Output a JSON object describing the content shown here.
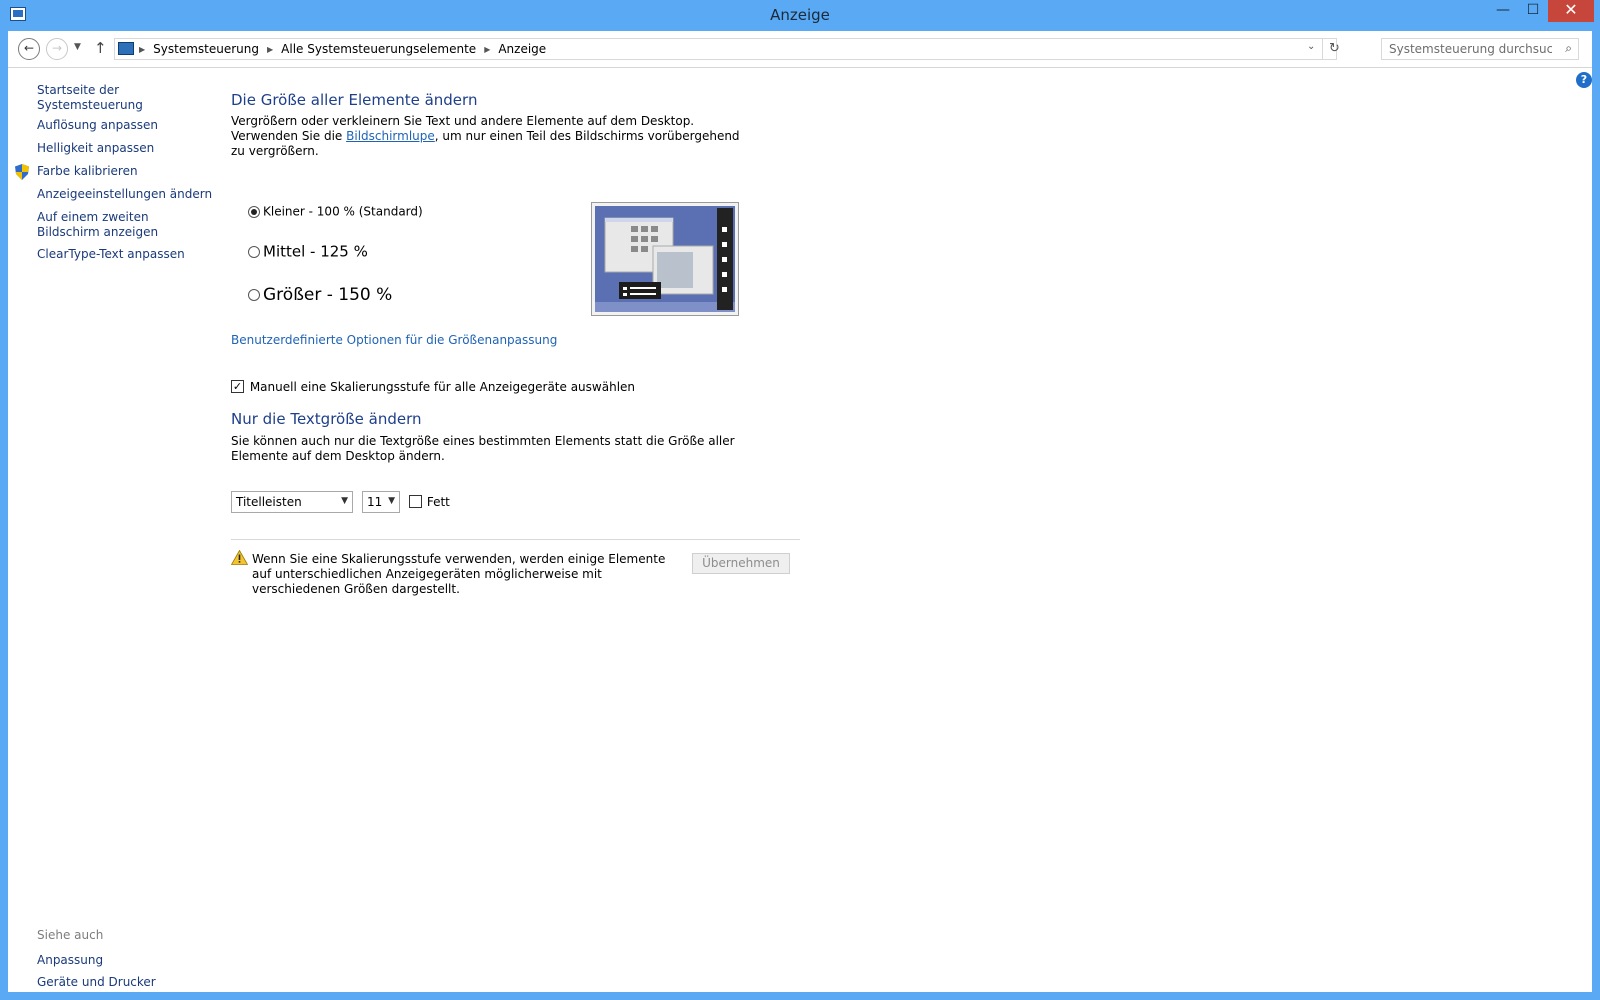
{
  "window": {
    "title": "Anzeige",
    "minimize": "—",
    "maximize": "☐",
    "close": "✕"
  },
  "nav": {
    "back": "←",
    "forward": "→",
    "recent": "▼",
    "up": "↑",
    "breadcrumbs": [
      "Systemsteuerung",
      "Alle Systemsteuerungselemente",
      "Anzeige"
    ],
    "breadcrumb_separator": "▶",
    "dropdown": "⌄",
    "refresh": "↻",
    "search_placeholder": "Systemsteuerung durchsuchen",
    "search_icon": "⌕"
  },
  "help": "?",
  "sidebar": {
    "home": "Startseite der Systemsteuerung",
    "items": [
      "Auflösung anpassen",
      "Helligkeit anpassen",
      "Farbe kalibrieren",
      "Anzeigeeinstellungen ändern",
      "Auf einem zweiten Bildschirm anzeigen",
      "ClearType-Text anpassen"
    ],
    "see_also": "Siehe auch",
    "see_also_items": [
      "Anpassung",
      "Geräte und Drucker"
    ]
  },
  "main": {
    "heading1": "Die Größe aller Elemente ändern",
    "intro_part1": "Vergrößern oder verkleinern Sie Text und andere Elemente auf dem Desktop. Verwenden Sie die ",
    "intro_link": "Bildschirmlupe",
    "intro_part2": ", um nur einen Teil des Bildschirms vorübergehend zu vergrößern.",
    "options": [
      {
        "label": "Kleiner - 100 % (Standard)",
        "checked": true
      },
      {
        "label": "Mittel - 125 %",
        "checked": false
      },
      {
        "label": "Größer - 150 %",
        "checked": false
      }
    ],
    "custom_link": "Benutzerdefinierte Optionen für die Größenanpassung",
    "manual_checkbox": "Manuell eine Skalierungsstufe für alle Anzeigegeräte auswählen",
    "manual_checked": true,
    "heading2": "Nur die Textgröße ändern",
    "text_desc": "Sie können auch nur die Textgröße eines bestimmten Elements statt die Größe aller Elemente auf dem Desktop ändern.",
    "element_select": "Titelleisten",
    "size_select": "11",
    "bold_label": "Fett",
    "bold_checked": false,
    "warning": "Wenn Sie eine Skalierungsstufe verwenden, werden einige Elemente auf unterschiedlichen Anzeigegeräten möglicherweise mit verschiedenen Größen dargestellt.",
    "apply_button": "Übernehmen"
  },
  "colors": {
    "titlebar": "#5aa9f5",
    "link": "#1f63b6",
    "heading": "#1e3f8a",
    "close_button": "#c7463c"
  }
}
